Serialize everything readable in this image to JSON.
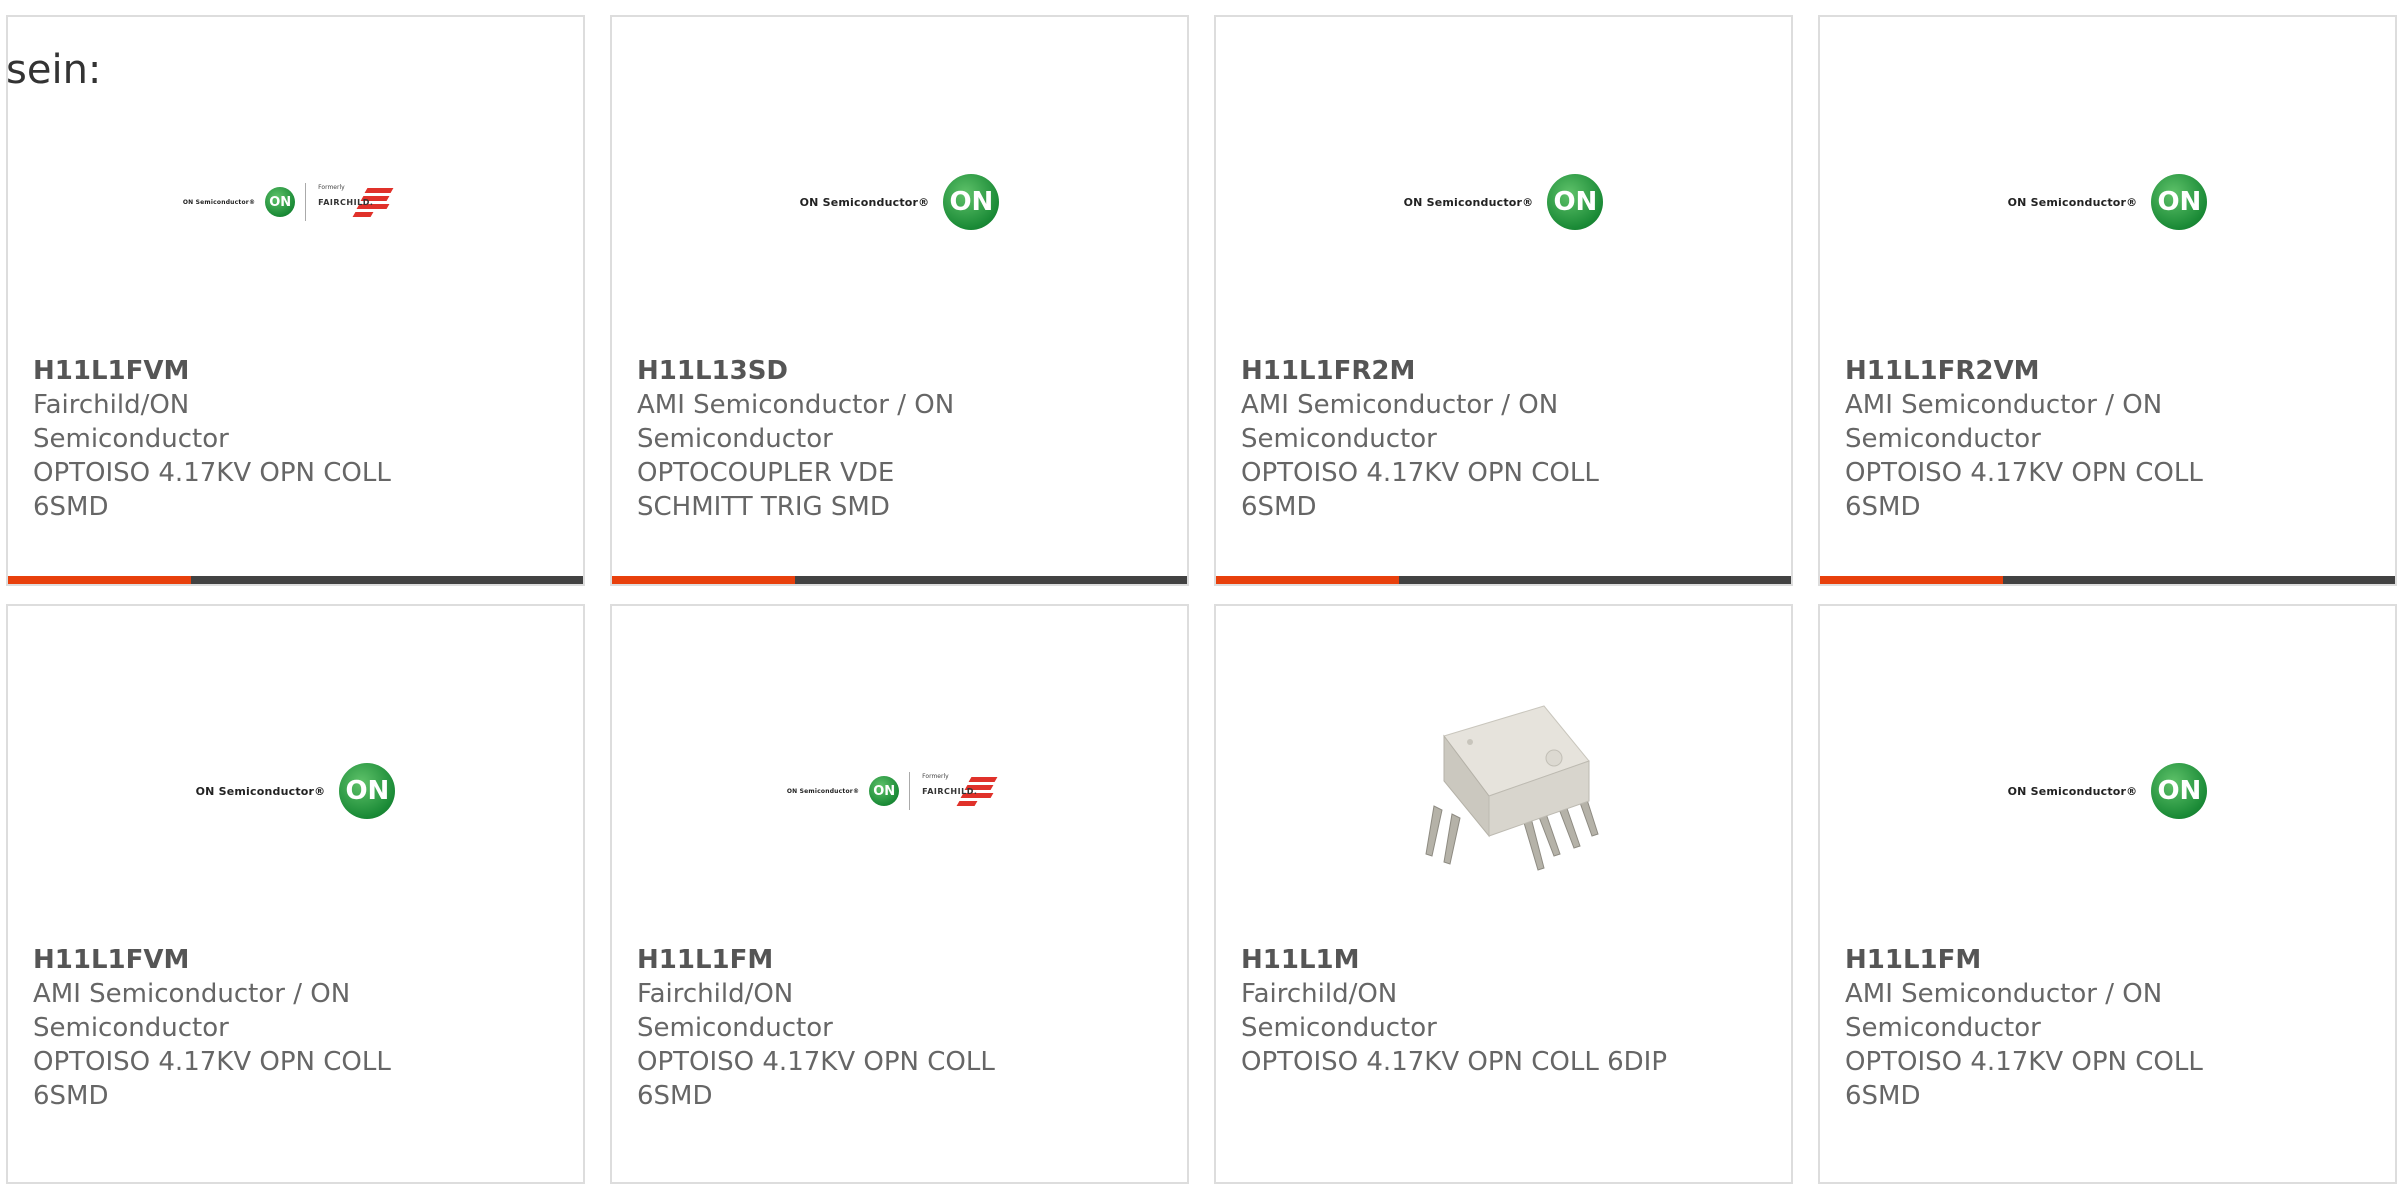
{
  "intro_text": "sein:",
  "products": [
    {
      "part": "H11L1FVM",
      "manufacturer": "Fairchild/ON Semiconductor",
      "description": "OPTOISO 4.17KV OPN COLL 6SMD",
      "logo": "fairchild-on-logo"
    },
    {
      "part": "H11L13SD",
      "manufacturer": "AMI Semiconductor / ON Semiconductor",
      "description": "OPTOCOUPLER VDE SCHMITT TRIG SMD",
      "logo": "on-semiconductor-logo"
    },
    {
      "part": "H11L1FR2M",
      "manufacturer": "AMI Semiconductor / ON Semiconductor",
      "description": "OPTOISO 4.17KV OPN COLL 6SMD",
      "logo": "on-semiconductor-logo"
    },
    {
      "part": "H11L1FR2VM",
      "manufacturer": "AMI Semiconductor / ON Semiconductor",
      "description": "OPTOISO 4.17KV OPN COLL 6SMD",
      "logo": "on-semiconductor-logo"
    },
    {
      "part": "H11L1FVM",
      "manufacturer": "AMI Semiconductor / ON Semiconductor",
      "description": "OPTOISO 4.17KV OPN COLL 6SMD",
      "logo": "on-semiconductor-logo"
    },
    {
      "part": "H11L1FM",
      "manufacturer": "Fairchild/ON Semiconductor",
      "description": "OPTOISO 4.17KV OPN COLL 6SMD",
      "logo": "fairchild-on-logo"
    },
    {
      "part": "H11L1M",
      "manufacturer": "Fairchild/ON Semiconductor",
      "description": "OPTOISO 4.17KV OPN COLL 6DIP",
      "logo": "dip-chip-photo"
    },
    {
      "part": "H11L1FM",
      "manufacturer": "AMI Semiconductor / ON Semiconductor",
      "description": "OPTOISO 4.17KV OPN COLL 6SMD",
      "logo": "on-semiconductor-logo"
    }
  ],
  "logo_text": {
    "on_semiconductor": "ON Semiconductor®",
    "on_mark": "ON",
    "formerly": "Formerly",
    "fairchild": "FAIRCHILD."
  },
  "colors": {
    "accent": "#e8400c",
    "bar": "#424242",
    "on_green": "#1a8a36",
    "fairchild_red": "#e0312a"
  }
}
